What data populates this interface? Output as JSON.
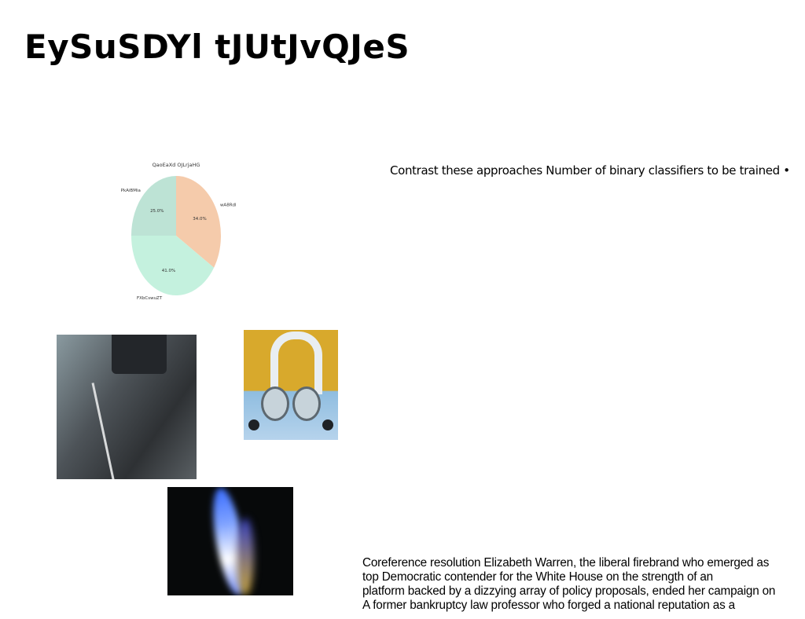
{
  "page": {
    "title": "EySuSDYl tJUtJvQJeS",
    "side_text": "Contrast these approaches Number of binary classifiers to be trained •",
    "body_lines": [
      "Coreference resolution Elizabeth Warren, the liberal firebrand who emerged as",
      "top Democratic contender for the White House on the strength of an",
      "platform backed by a dizzying array of policy proposals, ended her campaign on",
      "A former bankruptcy law professor who forged a national reputation as a"
    ]
  },
  "chart_data": {
    "type": "pie",
    "title": "QaoEaXd OJLrjaHG",
    "slices": [
      {
        "label": "wA8Rdl",
        "value": 34.0,
        "pct_label": "34.0%",
        "color": "#f5cbab"
      },
      {
        "label": "FXbCswuZT",
        "value": 41.0,
        "pct_label": "41.0%",
        "color": "#c4f1de"
      },
      {
        "label": "PkAiBMia",
        "value": 25.0,
        "pct_label": "25.0%",
        "color": "#bde3d5"
      }
    ],
    "start_angle": 90,
    "direction": "clockwise",
    "legend": "none"
  },
  "images": [
    {
      "name": "road-photo"
    },
    {
      "name": "robot-photo"
    },
    {
      "name": "flame-photo"
    }
  ]
}
